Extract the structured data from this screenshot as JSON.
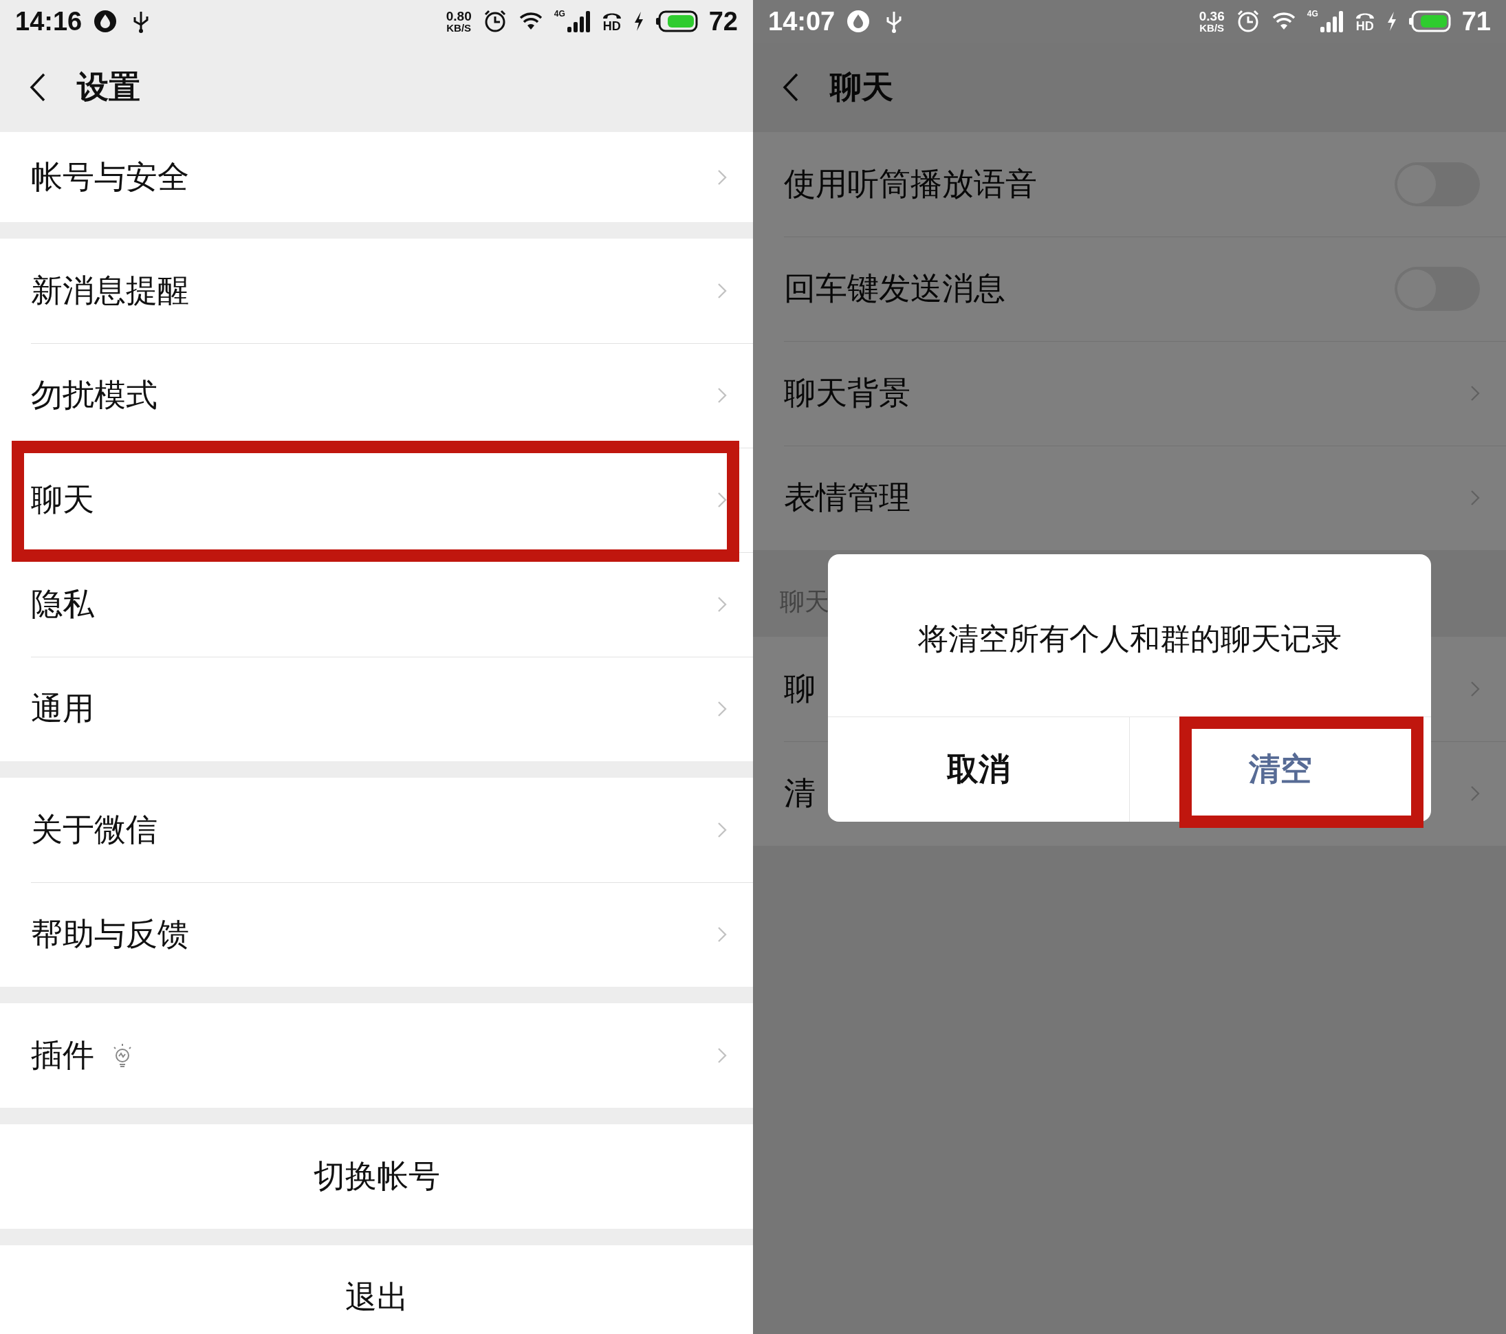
{
  "left_screen": {
    "status_bar": {
      "dimmed": false,
      "time": "14:16",
      "speed": "0.80",
      "speed_unit": "KB/S",
      "network": "4G",
      "call": "HD",
      "battery": "72"
    },
    "title": "设置",
    "groups": [
      {
        "items": [
          {
            "label": "帐号与安全",
            "kind": "plain",
            "highlighted": false
          }
        ]
      },
      {
        "items": [
          {
            "label": "新消息提醒",
            "kind": "plain",
            "highlighted": false
          },
          {
            "label": "勿扰模式",
            "kind": "plain",
            "highlighted": false
          },
          {
            "label": "聊天",
            "kind": "plain",
            "highlighted": true
          },
          {
            "label": "隐私",
            "kind": "plain",
            "highlighted": false
          },
          {
            "label": "通用",
            "kind": "plain",
            "highlighted": false
          }
        ]
      },
      {
        "items": [
          {
            "label": "关于微信",
            "kind": "plain",
            "highlighted": false
          },
          {
            "label": "帮助与反馈",
            "kind": "plain",
            "highlighted": false
          }
        ]
      },
      {
        "items": [
          {
            "label": "插件",
            "kind": "badged",
            "highlighted": false
          }
        ]
      }
    ],
    "actions": [
      "切换帐号",
      "退出"
    ]
  },
  "right_screen": {
    "status_bar": {
      "dimmed": true,
      "time": "14:07",
      "speed": "0.36",
      "speed_unit": "KB/S",
      "network": "4G",
      "call": "HD",
      "battery": "71"
    },
    "title": "聊天",
    "rows": [
      {
        "label": "使用听筒播放语音",
        "kind": "toggle",
        "on": false
      },
      {
        "label": "回车键发送消息",
        "kind": "toggle",
        "on": false
      },
      {
        "label": "聊天背景",
        "kind": "link"
      },
      {
        "label": "表情管理",
        "kind": "link"
      }
    ],
    "section_label": "聊天",
    "section_rows": [
      "聊",
      "清"
    ],
    "dialog": {
      "message": "将清空所有个人和群的聊天记录",
      "buttons": [
        {
          "label": "取消",
          "kind": "cancel",
          "highlighted": false
        },
        {
          "label": "清空",
          "kind": "confirm",
          "highlighted": true
        }
      ]
    }
  }
}
